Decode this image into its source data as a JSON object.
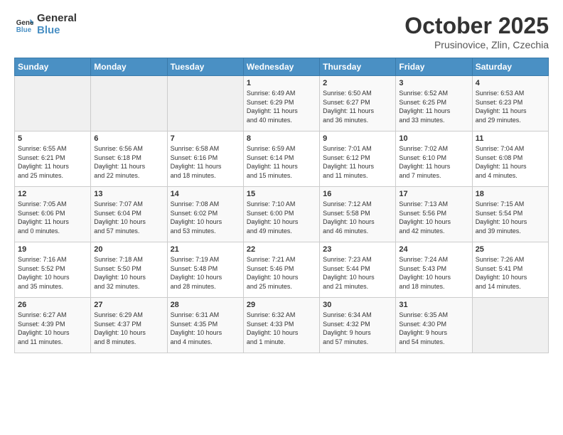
{
  "header": {
    "logo_line1": "General",
    "logo_line2": "Blue",
    "month": "October 2025",
    "location": "Prusinovice, Zlin, Czechia"
  },
  "days_of_week": [
    "Sunday",
    "Monday",
    "Tuesday",
    "Wednesday",
    "Thursday",
    "Friday",
    "Saturday"
  ],
  "weeks": [
    [
      {
        "num": "",
        "info": ""
      },
      {
        "num": "",
        "info": ""
      },
      {
        "num": "",
        "info": ""
      },
      {
        "num": "1",
        "info": "Sunrise: 6:49 AM\nSunset: 6:29 PM\nDaylight: 11 hours\nand 40 minutes."
      },
      {
        "num": "2",
        "info": "Sunrise: 6:50 AM\nSunset: 6:27 PM\nDaylight: 11 hours\nand 36 minutes."
      },
      {
        "num": "3",
        "info": "Sunrise: 6:52 AM\nSunset: 6:25 PM\nDaylight: 11 hours\nand 33 minutes."
      },
      {
        "num": "4",
        "info": "Sunrise: 6:53 AM\nSunset: 6:23 PM\nDaylight: 11 hours\nand 29 minutes."
      }
    ],
    [
      {
        "num": "5",
        "info": "Sunrise: 6:55 AM\nSunset: 6:21 PM\nDaylight: 11 hours\nand 25 minutes."
      },
      {
        "num": "6",
        "info": "Sunrise: 6:56 AM\nSunset: 6:18 PM\nDaylight: 11 hours\nand 22 minutes."
      },
      {
        "num": "7",
        "info": "Sunrise: 6:58 AM\nSunset: 6:16 PM\nDaylight: 11 hours\nand 18 minutes."
      },
      {
        "num": "8",
        "info": "Sunrise: 6:59 AM\nSunset: 6:14 PM\nDaylight: 11 hours\nand 15 minutes."
      },
      {
        "num": "9",
        "info": "Sunrise: 7:01 AM\nSunset: 6:12 PM\nDaylight: 11 hours\nand 11 minutes."
      },
      {
        "num": "10",
        "info": "Sunrise: 7:02 AM\nSunset: 6:10 PM\nDaylight: 11 hours\nand 7 minutes."
      },
      {
        "num": "11",
        "info": "Sunrise: 7:04 AM\nSunset: 6:08 PM\nDaylight: 11 hours\nand 4 minutes."
      }
    ],
    [
      {
        "num": "12",
        "info": "Sunrise: 7:05 AM\nSunset: 6:06 PM\nDaylight: 11 hours\nand 0 minutes."
      },
      {
        "num": "13",
        "info": "Sunrise: 7:07 AM\nSunset: 6:04 PM\nDaylight: 10 hours\nand 57 minutes."
      },
      {
        "num": "14",
        "info": "Sunrise: 7:08 AM\nSunset: 6:02 PM\nDaylight: 10 hours\nand 53 minutes."
      },
      {
        "num": "15",
        "info": "Sunrise: 7:10 AM\nSunset: 6:00 PM\nDaylight: 10 hours\nand 49 minutes."
      },
      {
        "num": "16",
        "info": "Sunrise: 7:12 AM\nSunset: 5:58 PM\nDaylight: 10 hours\nand 46 minutes."
      },
      {
        "num": "17",
        "info": "Sunrise: 7:13 AM\nSunset: 5:56 PM\nDaylight: 10 hours\nand 42 minutes."
      },
      {
        "num": "18",
        "info": "Sunrise: 7:15 AM\nSunset: 5:54 PM\nDaylight: 10 hours\nand 39 minutes."
      }
    ],
    [
      {
        "num": "19",
        "info": "Sunrise: 7:16 AM\nSunset: 5:52 PM\nDaylight: 10 hours\nand 35 minutes."
      },
      {
        "num": "20",
        "info": "Sunrise: 7:18 AM\nSunset: 5:50 PM\nDaylight: 10 hours\nand 32 minutes."
      },
      {
        "num": "21",
        "info": "Sunrise: 7:19 AM\nSunset: 5:48 PM\nDaylight: 10 hours\nand 28 minutes."
      },
      {
        "num": "22",
        "info": "Sunrise: 7:21 AM\nSunset: 5:46 PM\nDaylight: 10 hours\nand 25 minutes."
      },
      {
        "num": "23",
        "info": "Sunrise: 7:23 AM\nSunset: 5:44 PM\nDaylight: 10 hours\nand 21 minutes."
      },
      {
        "num": "24",
        "info": "Sunrise: 7:24 AM\nSunset: 5:43 PM\nDaylight: 10 hours\nand 18 minutes."
      },
      {
        "num": "25",
        "info": "Sunrise: 7:26 AM\nSunset: 5:41 PM\nDaylight: 10 hours\nand 14 minutes."
      }
    ],
    [
      {
        "num": "26",
        "info": "Sunrise: 6:27 AM\nSunset: 4:39 PM\nDaylight: 10 hours\nand 11 minutes."
      },
      {
        "num": "27",
        "info": "Sunrise: 6:29 AM\nSunset: 4:37 PM\nDaylight: 10 hours\nand 8 minutes."
      },
      {
        "num": "28",
        "info": "Sunrise: 6:31 AM\nSunset: 4:35 PM\nDaylight: 10 hours\nand 4 minutes."
      },
      {
        "num": "29",
        "info": "Sunrise: 6:32 AM\nSunset: 4:33 PM\nDaylight: 10 hours\nand 1 minute."
      },
      {
        "num": "30",
        "info": "Sunrise: 6:34 AM\nSunset: 4:32 PM\nDaylight: 9 hours\nand 57 minutes."
      },
      {
        "num": "31",
        "info": "Sunrise: 6:35 AM\nSunset: 4:30 PM\nDaylight: 9 hours\nand 54 minutes."
      },
      {
        "num": "",
        "info": ""
      }
    ]
  ]
}
